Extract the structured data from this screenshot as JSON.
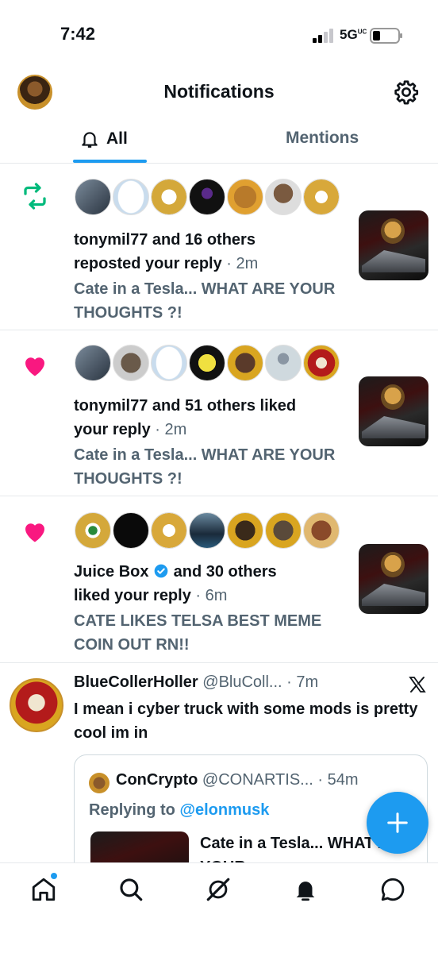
{
  "status_bar": {
    "time": "7:42",
    "network": "5G",
    "network_suffix": "UC"
  },
  "header": {
    "title": "Notifications"
  },
  "tabs": [
    {
      "label": "All",
      "active": true
    },
    {
      "label": "Mentions",
      "active": false
    }
  ],
  "notifications": [
    {
      "type": "repost",
      "icon": "repost-icon",
      "actor": "tonymil77",
      "summary_prefix": "tonymil77 and 16 others",
      "summary_line2": "reposted your reply",
      "time": "2m",
      "preview": "Cate in a Tesla... WHAT ARE YOUR THOUGHTS ?!",
      "accent": "#00ba7c"
    },
    {
      "type": "like",
      "icon": "heart-icon",
      "summary_prefix": "tonymil77 and 51 others liked",
      "summary_line2": "your reply",
      "time": "2m",
      "preview": "Cate in a Tesla... WHAT ARE YOUR THOUGHTS ?!",
      "accent": "#f91880"
    },
    {
      "type": "like",
      "icon": "heart-icon",
      "actor": "Juice Box",
      "summary_suffix": "and 30 others",
      "summary_line2": "liked your reply",
      "time": "6m",
      "preview": "CATE LIKES TELSA BEST MEME COIN OUT RN!!",
      "accent": "#f91880"
    }
  ],
  "tweet": {
    "name": "BlueCollerHoller",
    "handle": "@BluColl...",
    "time": "7m",
    "body": "I mean i cyber truck with some mods is pretty cool im in",
    "quote": {
      "name": "ConCrypto",
      "handle": "@CONARTIS...",
      "time": "54m",
      "replying_label": "Replying to",
      "replying_to": "@elonmusk",
      "text": "Cate in a Tesla... WHAT ARE YOUR"
    }
  },
  "colors": {
    "accent": "#1d9bf0",
    "secondary_text": "#536471",
    "like": "#f91880",
    "repost": "#00ba7c"
  },
  "bottom_nav": [
    "home-icon",
    "search-icon",
    "grok-icon",
    "notifications-icon",
    "messages-icon"
  ]
}
